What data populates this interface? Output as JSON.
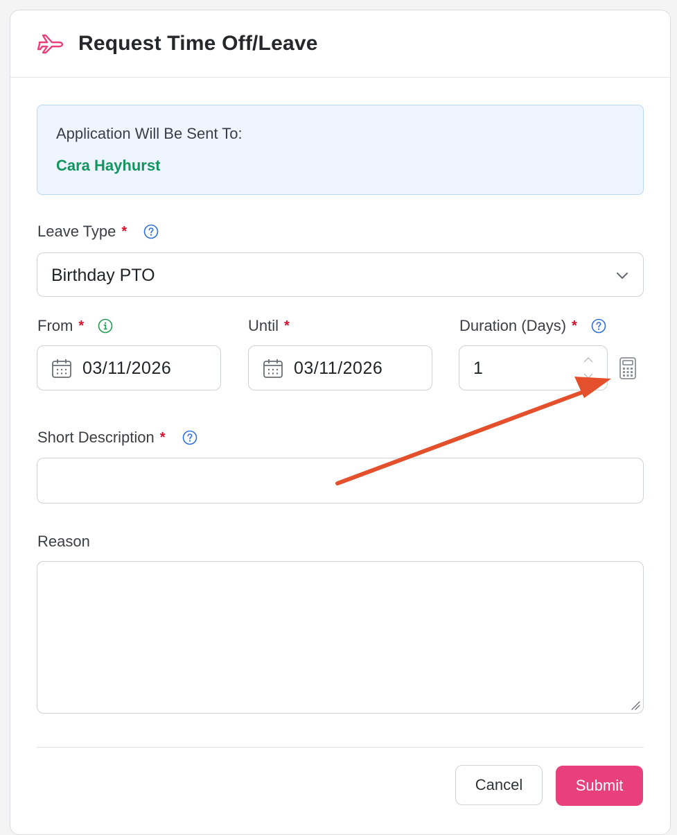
{
  "header": {
    "title": "Request Time Off/Leave",
    "icon": "plane-icon"
  },
  "recipient": {
    "label": "Application Will Be Sent To:",
    "name": "Cara Hayhurst"
  },
  "leave_type": {
    "label": "Leave Type",
    "required_mark": "*",
    "value": "Birthday PTO"
  },
  "from": {
    "label": "From",
    "required_mark": "*",
    "value": "03/11/2026"
  },
  "until": {
    "label": "Until",
    "required_mark": "*",
    "value": "03/11/2026"
  },
  "duration": {
    "label": "Duration (Days)",
    "required_mark": "*",
    "value": "1"
  },
  "short_description": {
    "label": "Short Description",
    "required_mark": "*",
    "value": ""
  },
  "reason": {
    "label": "Reason",
    "value": ""
  },
  "buttons": {
    "cancel": "Cancel",
    "submit": "Submit"
  },
  "colors": {
    "accent_pink": "#e8407a",
    "required_red": "#d4122a",
    "recipient_green": "#13955f",
    "help_blue": "#2f6fdc",
    "info_green": "#1f9d55",
    "annotation_arrow": "#e4502b"
  }
}
